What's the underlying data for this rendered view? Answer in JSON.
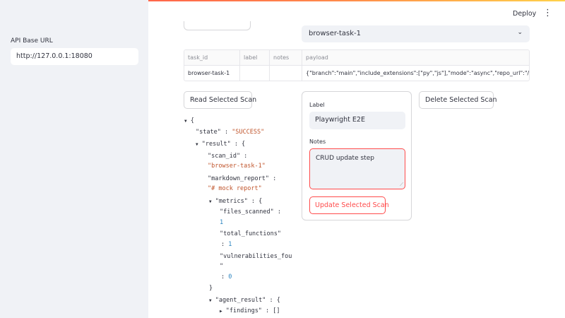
{
  "sidebar": {
    "api_label": "API Base URL",
    "api_value": "http://127.0.0.1:18080"
  },
  "header": {
    "deploy_label": "Deploy",
    "menu_icon": "kebab-vertical-icon"
  },
  "selector": {
    "value": "browser-task-1",
    "icon": "chevron-down-icon"
  },
  "table": {
    "columns": [
      "task_id",
      "label",
      "notes",
      "payload"
    ],
    "rows": [
      [
        "browser-task-1",
        "",
        "",
        "{\"branch\":\"main\",\"include_extensions\":[\"py\",\"js\"],\"mode\":\"async\",\"repo_url\":\"/home/run"
      ]
    ]
  },
  "actions": {
    "read": "Read Selected Scan",
    "delete": "Delete Selected Scan",
    "update": "Update Selected Scan"
  },
  "form": {
    "label_title": "Label",
    "label_value": "Playwright E2E",
    "notes_title": "Notes",
    "notes_value": "CRUD update step"
  },
  "json": {
    "open_brace": "{",
    "state_key": "\"state\"",
    "state_value": "\"SUCCESS\"",
    "result_key": "\"result\"",
    "scan_id_key": "\"scan_id\"",
    "scan_id_value": "\"browser-task-1\"",
    "md_key": "\"markdown_report\"",
    "md_value": "\"# mock report\"",
    "metrics_key": "\"metrics\"",
    "files_key": "\"files_scanned\"",
    "files_value": "1",
    "funcs_key": "\"total_functions\"",
    "funcs_value": "1",
    "vuln_key_a": "\"vulnerabilities_fou",
    "vuln_key_b": "\"",
    "vuln_value": "0",
    "close_brace": "}",
    "agent_key": "\"agent_result\"",
    "findings_key": "\"findings\"",
    "findings_value": "[]"
  },
  "colors": {
    "accent": "#ff4b4b",
    "sidebar_bg": "#f0f2f6",
    "json_string": "#c0552c",
    "json_number": "#2e86c1"
  }
}
